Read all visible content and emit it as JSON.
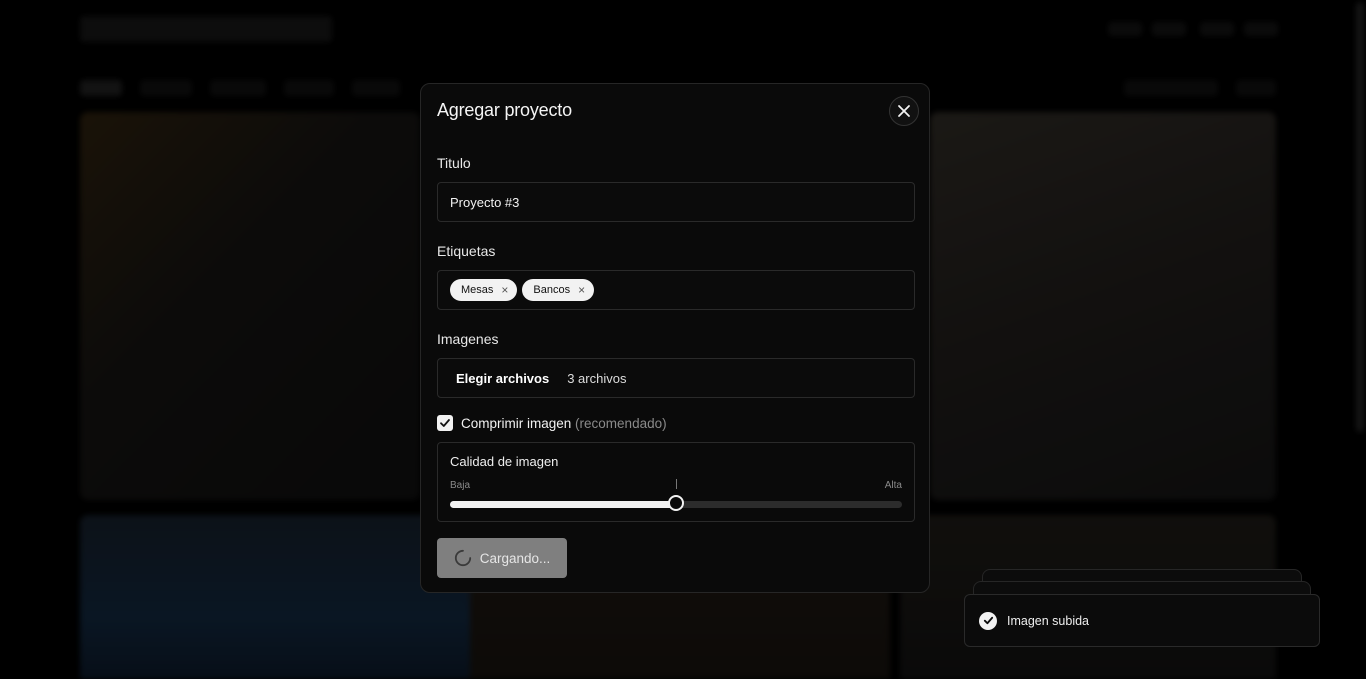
{
  "modal": {
    "title": "Agregar proyecto",
    "close_icon": "close-icon",
    "title_field": {
      "label": "Titulo",
      "value": "Proyecto #3"
    },
    "tags_field": {
      "label": "Etiquetas",
      "tags": [
        {
          "label": "Mesas"
        },
        {
          "label": "Bancos"
        }
      ],
      "remove_icon": "×"
    },
    "images_field": {
      "label": "Imagenes",
      "button_label": "Elegir archivos",
      "file_count": "3 archivos"
    },
    "compress": {
      "checked": true,
      "label": "Comprimir imagen",
      "hint": "(recomendado)"
    },
    "quality": {
      "title": "Calidad de imagen",
      "low_label": "Baja",
      "high_label": "Alta",
      "value_fraction": 0.5
    },
    "submit": {
      "label": "Cargando...",
      "state": "loading",
      "icon": "spinner-icon"
    }
  },
  "toast": {
    "message": "Imagen subida",
    "icon": "check-circle-icon"
  },
  "colors": {
    "background": "#000000",
    "modal_bg": "#0a0a0a",
    "accent": "#f2f2f2",
    "loading_button": "#7f7f7f"
  }
}
